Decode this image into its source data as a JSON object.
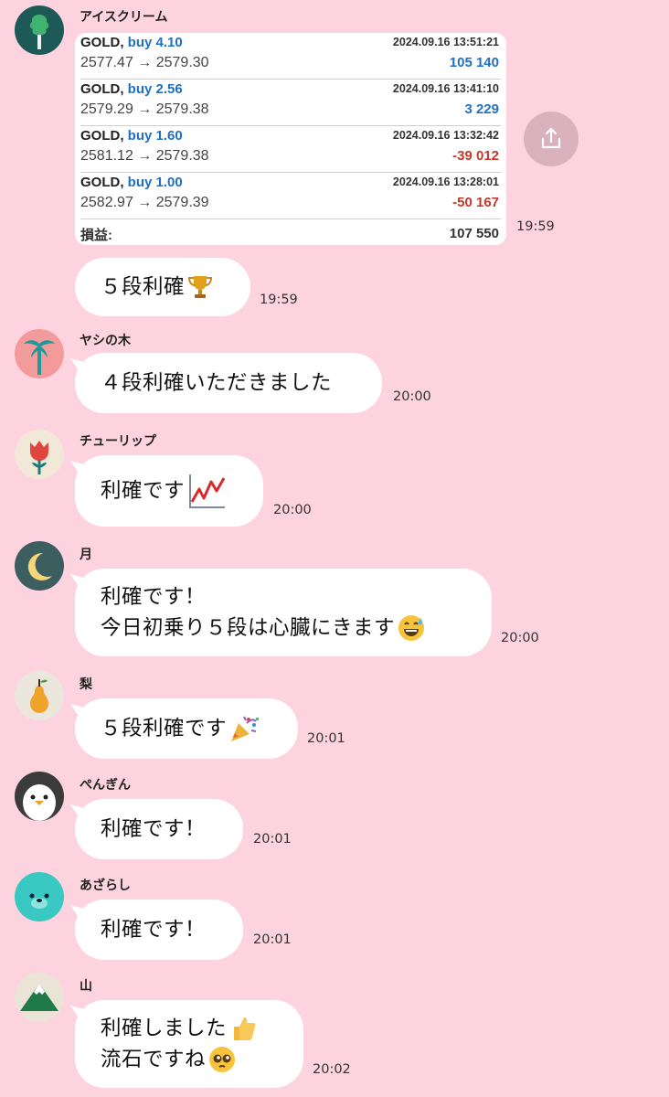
{
  "trade_card": {
    "sender": "アイスクリーム",
    "trades": [
      {
        "symbol": "GOLD,",
        "side": "buy 4.10",
        "time": "2024.09.16 13:51:21",
        "prices": "2577.47 → 2579.30",
        "profit": "105 140",
        "status": "positive"
      },
      {
        "symbol": "GOLD,",
        "side": "buy 2.56",
        "time": "2024.09.16 13:41:10",
        "prices": "2579.29 → 2579.38",
        "profit": "3 229",
        "status": "positive"
      },
      {
        "symbol": "GOLD,",
        "side": "buy 1.60",
        "time": "2024.09.16 13:32:42",
        "prices": "2581.12 → 2579.38",
        "profit": "-39 012",
        "status": "negative"
      },
      {
        "symbol": "GOLD,",
        "side": "buy 1.00",
        "time": "2024.09.16 13:28:01",
        "prices": "2582.97 → 2579.39",
        "profit": "-50 167",
        "status": "negative"
      }
    ],
    "total_label": "損益:",
    "total_value": "107 550",
    "time": "19:59"
  },
  "colors": {
    "background": "#fdd3df",
    "profit_positive": "#1f6fc4",
    "profit_negative": "#c0392b"
  },
  "messages": [
    {
      "sender": "",
      "lines": [
        "５段利確"
      ],
      "emoji": "trophy-icon",
      "time": "19:59"
    },
    {
      "sender": "ヤシの木",
      "avatar": "palm-tree-icon",
      "lines": [
        "４段利確いただきました"
      ],
      "time": "20:00"
    },
    {
      "sender": "チューリップ",
      "avatar": "tulip-icon",
      "lines": [
        "利確です"
      ],
      "emoji": "chart-up-icon",
      "time": "20:00"
    },
    {
      "sender": "月",
      "avatar": "moon-icon",
      "lines": [
        "利確です！",
        "今日初乗り５段は心臓にきます"
      ],
      "emoji": "sweat-smile-icon",
      "time": "20:00"
    },
    {
      "sender": "梨",
      "avatar": "pear-icon",
      "lines": [
        "５段利確です"
      ],
      "emoji": "party-popper-icon",
      "time": "20:01"
    },
    {
      "sender": "ぺんぎん",
      "avatar": "penguin-icon",
      "lines": [
        "利確です！"
      ],
      "time": "20:01"
    },
    {
      "sender": "あざらし",
      "avatar": "seal-icon",
      "lines": [
        "利確です！"
      ],
      "time": "20:01"
    },
    {
      "sender": "山",
      "avatar": "mountain-icon",
      "lines": [
        "利確しました",
        "流石ですね"
      ],
      "emoji": "thumbs-up-icon",
      "emoji2": "pleading-face-icon",
      "time": "20:02"
    }
  ]
}
